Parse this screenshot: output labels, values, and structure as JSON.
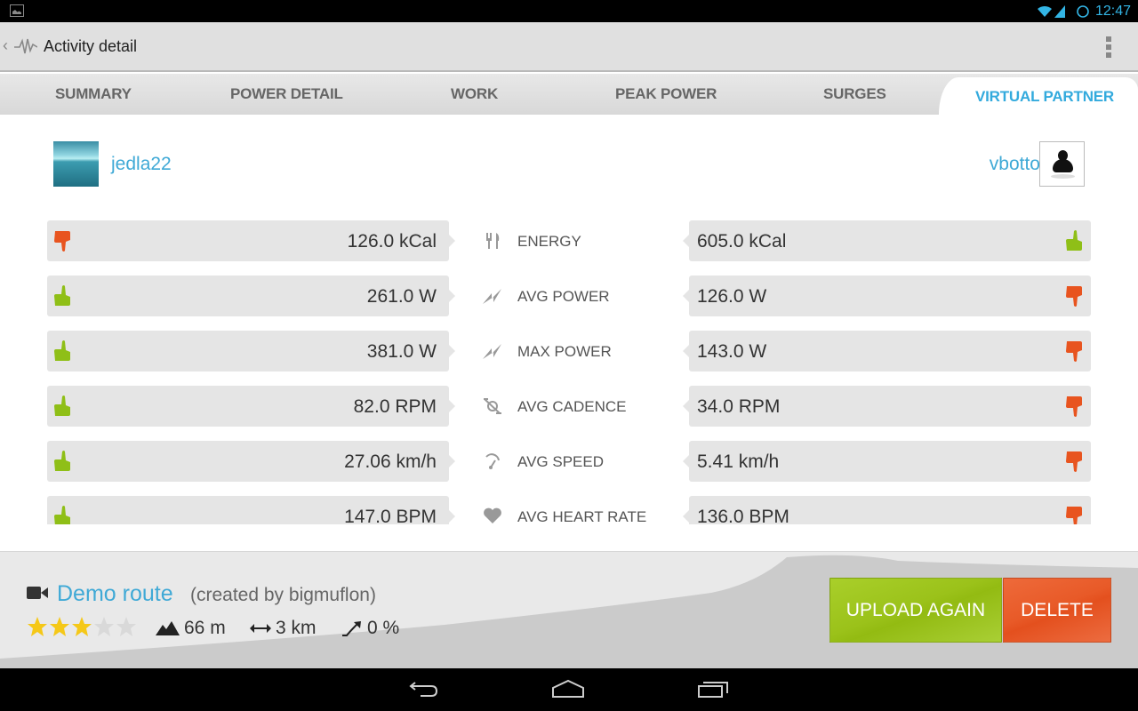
{
  "status_bar": {
    "time": "12:47",
    "icons": [
      "image-notification-icon",
      "wifi-icon",
      "signal-icon",
      "sync-icon"
    ]
  },
  "action_bar": {
    "title": "Activity detail",
    "icons": [
      "up-caret-icon",
      "activity-pulse-icon",
      "overflow-menu-icon"
    ]
  },
  "tabs": [
    {
      "label": "SUMMARY",
      "active": false
    },
    {
      "label": "POWER DETAIL",
      "active": false
    },
    {
      "label": "WORK",
      "active": false
    },
    {
      "label": "PEAK POWER",
      "active": false
    },
    {
      "label": "SURGES",
      "active": false
    },
    {
      "label": "VIRTUAL PARTNER",
      "active": true
    }
  ],
  "users": {
    "left": {
      "name": "jedla22"
    },
    "right": {
      "name": "vbotto"
    }
  },
  "metrics": [
    {
      "label": "ENERGY",
      "icon": "fork-knife-icon",
      "left": {
        "value": "126.0 kCal",
        "verdict": "thumbs-down"
      },
      "right": {
        "value": "605.0 kCal",
        "verdict": "thumbs-up"
      }
    },
    {
      "label": "AVG POWER",
      "icon": "lightning-icon",
      "left": {
        "value": "261.0 W",
        "verdict": "thumbs-up"
      },
      "right": {
        "value": "126.0 W",
        "verdict": "thumbs-down"
      }
    },
    {
      "label": "MAX POWER",
      "icon": "lightning-icon",
      "left": {
        "value": "381.0 W",
        "verdict": "thumbs-up"
      },
      "right": {
        "value": "143.0 W",
        "verdict": "thumbs-down"
      }
    },
    {
      "label": "AVG CADENCE",
      "icon": "cadence-icon",
      "left": {
        "value": "82.0 RPM",
        "verdict": "thumbs-up"
      },
      "right": {
        "value": "34.0 RPM",
        "verdict": "thumbs-down"
      }
    },
    {
      "label": "AVG SPEED",
      "icon": "speedometer-icon",
      "left": {
        "value": "27.06 km/h",
        "verdict": "thumbs-up"
      },
      "right": {
        "value": "5.41 km/h",
        "verdict": "thumbs-down"
      }
    },
    {
      "label": "AVG HEART RATE",
      "icon": "heart-icon",
      "left": {
        "value": "147.0 BPM",
        "verdict": "thumbs-up"
      },
      "right": {
        "value": "136.0 BPM",
        "verdict": "thumbs-down"
      }
    }
  ],
  "route": {
    "name": "Demo route",
    "creator": "(created by bigmuflon)",
    "rating": 3,
    "rating_max": 5,
    "elevation": "66 m",
    "distance": "3 km",
    "slope": "0 %"
  },
  "buttons": {
    "upload": "UPLOAD AGAIN",
    "delete": "DELETE"
  },
  "colors": {
    "accent": "#33aadd",
    "thumbs_up": "#8fbf17",
    "thumbs_down": "#e8541f",
    "upload_button": "#9bc21a",
    "delete_button": "#e85a28"
  },
  "nav_bar": [
    "back-icon",
    "home-icon",
    "recent-apps-icon"
  ]
}
